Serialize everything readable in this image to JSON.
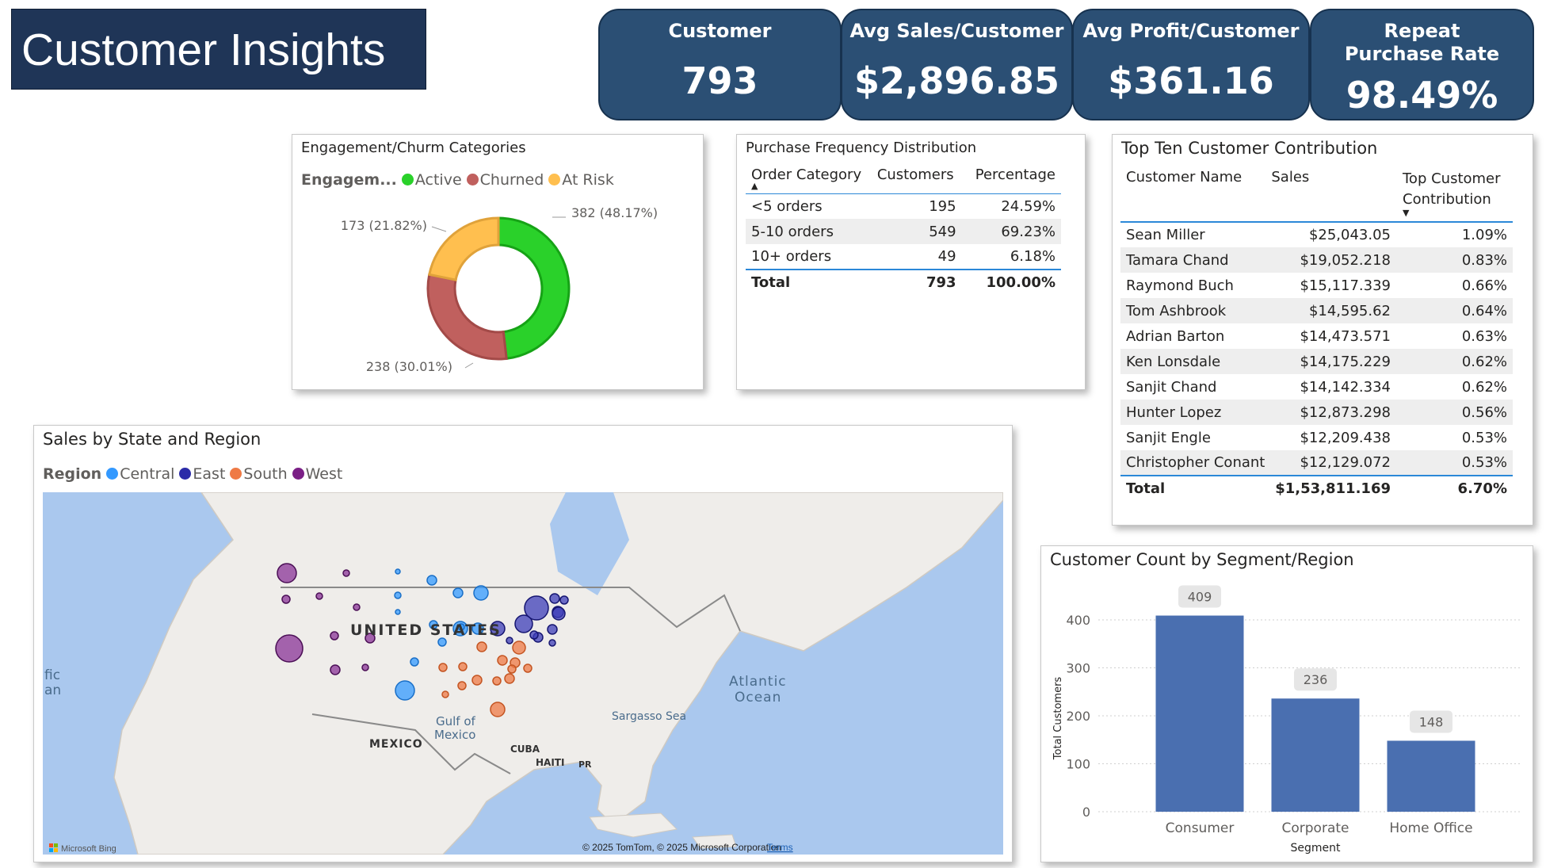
{
  "header": {
    "title": "Customer Insights"
  },
  "kpis": [
    {
      "label": "Customer",
      "value": "793"
    },
    {
      "label": "Avg Sales/Customer",
      "value": "$2,896.85"
    },
    {
      "label": "Avg Profit/Customer",
      "value": "$361.16"
    },
    {
      "label": "Repeat Purchase Rate",
      "value": "98.49%"
    }
  ],
  "engagement": {
    "title": "Engagement/Churm Categories",
    "legend_title": "Engagem...",
    "chart_data": {
      "type": "pie",
      "subtype": "donut",
      "categories": [
        "Active",
        "Churned",
        "At Risk"
      ],
      "values": [
        382,
        238,
        173
      ],
      "percents": [
        48.17,
        30.01,
        21.82
      ],
      "labels": [
        "382 (48.17%)",
        "238 (30.01%)",
        "173 (21.82%)"
      ],
      "colors": [
        "#2ad12a",
        "#c0605e",
        "#ffbf4f"
      ]
    }
  },
  "frequency": {
    "title": "Purchase Frequency Distribution",
    "columns": [
      "Order Category",
      "Customers",
      "Percentage"
    ],
    "rows": [
      {
        "category": "<5 orders",
        "customers": "195",
        "percentage": "24.59%"
      },
      {
        "category": "5-10 orders",
        "customers": "549",
        "percentage": "69.23%"
      },
      {
        "category": "10+ orders",
        "customers": "49",
        "percentage": "6.18%"
      }
    ],
    "total": {
      "label": "Total",
      "customers": "793",
      "percentage": "100.00%"
    }
  },
  "top_ten": {
    "title": "Top Ten Customer Contribution",
    "columns": [
      "Customer Name",
      "Sales",
      "Top Customer Contribution"
    ],
    "rows": [
      {
        "name": "Sean Miller",
        "sales": "$25,043.05",
        "contribution": "1.09%"
      },
      {
        "name": "Tamara Chand",
        "sales": "$19,052.218",
        "contribution": "0.83%"
      },
      {
        "name": "Raymond Buch",
        "sales": "$15,117.339",
        "contribution": "0.66%"
      },
      {
        "name": "Tom Ashbrook",
        "sales": "$14,595.62",
        "contribution": "0.64%"
      },
      {
        "name": "Adrian Barton",
        "sales": "$14,473.571",
        "contribution": "0.63%"
      },
      {
        "name": "Ken Lonsdale",
        "sales": "$14,175.229",
        "contribution": "0.62%"
      },
      {
        "name": "Sanjit Chand",
        "sales": "$14,142.334",
        "contribution": "0.62%"
      },
      {
        "name": "Hunter Lopez",
        "sales": "$12,873.298",
        "contribution": "0.56%"
      },
      {
        "name": "Sanjit Engle",
        "sales": "$12,209.438",
        "contribution": "0.53%"
      },
      {
        "name": "Christopher Conant",
        "sales": "$12,129.072",
        "contribution": "0.53%"
      }
    ],
    "total": {
      "label": "Total",
      "sales": "$1,53,811.169",
      "contribution": "6.70%"
    }
  },
  "map": {
    "title": "Sales by State and Region",
    "legend_title": "Region",
    "regions": [
      {
        "name": "Central",
        "color": "#3399ff"
      },
      {
        "name": "East",
        "color": "#2b2ba8"
      },
      {
        "name": "South",
        "color": "#ef7a45"
      },
      {
        "name": "West",
        "color": "#7b1f86"
      }
    ],
    "labels": {
      "country": "UNITED STATES",
      "ocean": "Atlantic Ocean",
      "sea": "Sargasso Sea",
      "gulf": "Gulf of Mexico",
      "mexico": "MEXICO",
      "cuba": "CUBA",
      "haiti": "HAITI",
      "pr": "PR",
      "pacific_partial": "fic an",
      "attribution": "© 2025 TomTom, © 2025 Microsoft Corporation",
      "terms": "Terms",
      "bing": "Microsoft Bing"
    }
  },
  "segment": {
    "title": "Customer Count by Segment/Region",
    "chart_data": {
      "type": "bar",
      "categories": [
        "Consumer",
        "Corporate",
        "Home Office"
      ],
      "values": [
        409,
        236,
        148
      ],
      "xlabel": "Segment",
      "ylabel": "Total Customers",
      "ylim": [
        0,
        450
      ],
      "yticks": [
        0,
        100,
        200,
        300,
        400
      ],
      "grid": true,
      "color": "#4a6fb0"
    }
  }
}
